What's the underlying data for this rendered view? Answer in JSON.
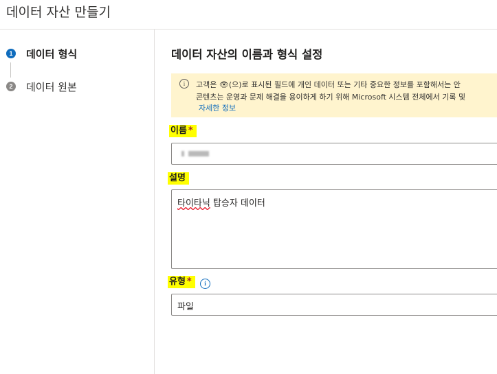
{
  "header": {
    "title": "데이터 자산 만들기"
  },
  "steps": [
    {
      "number": "1",
      "label": "데이터 형식",
      "state": "active"
    },
    {
      "number": "2",
      "label": "데이터 원본",
      "state": "pending"
    }
  ],
  "main": {
    "heading": "데이터 자산의 이름과 형식 설정",
    "info_banner": {
      "icon": "info-icon",
      "line1": "고객은 👁(으)로 표시된 필드에 개인 데이터 또는 기타 중요한 정보를 포함해서는 안",
      "line2": "콘텐츠는 운영과 문제 해결을 용이하게 하기 위해 Microsoft 시스템 전체에서 기록 및",
      "link": "자세한 정보"
    },
    "fields": {
      "name": {
        "label": "이름",
        "required_mark": "*"
      },
      "description": {
        "label": "설명",
        "part1": "타이타닉",
        "part2": " 탑승자 데이터"
      },
      "type": {
        "label": "유형",
        "required_mark": "*",
        "value": "파일",
        "help_icon": "info-circle-icon"
      }
    }
  },
  "colors": {
    "accent": "#0f6cbd",
    "banner_bg": "#fff4ce",
    "highlight": "#ffff00",
    "required": "#a4262c"
  }
}
